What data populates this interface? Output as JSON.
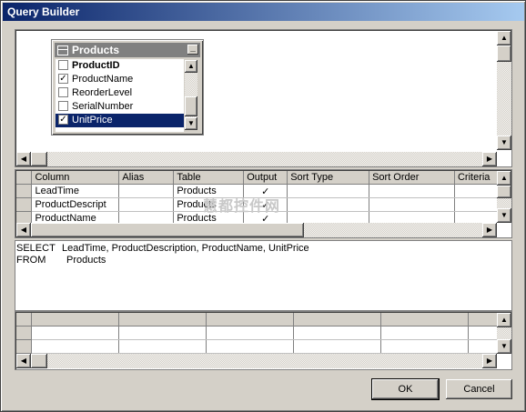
{
  "window": {
    "title": "Query Builder"
  },
  "diagram": {
    "table": {
      "name": "Products",
      "fields": [
        {
          "name": "ProductID",
          "checked": false,
          "bold": true,
          "selected": false
        },
        {
          "name": "ProductName",
          "checked": true,
          "bold": false,
          "selected": false
        },
        {
          "name": "ReorderLevel",
          "checked": false,
          "bold": false,
          "selected": false
        },
        {
          "name": "SerialNumber",
          "checked": false,
          "bold": false,
          "selected": false
        },
        {
          "name": "UnitPrice",
          "checked": true,
          "bold": false,
          "selected": true
        }
      ]
    }
  },
  "grid": {
    "columns": [
      "Column",
      "Alias",
      "Table",
      "Output",
      "Sort Type",
      "Sort Order",
      "Criteria"
    ],
    "rows": [
      {
        "column": "LeadTime",
        "alias": "",
        "table": "Products",
        "output": "✓"
      },
      {
        "column": "ProductDescript",
        "alias": "",
        "table": "Products",
        "output": "✓"
      },
      {
        "column": "ProductName",
        "alias": "",
        "table": "Products",
        "output": "✓"
      }
    ]
  },
  "sql": {
    "select_kw": "SELECT",
    "select_list": "LeadTime, ProductDescription, ProductName, UnitPrice",
    "from_kw": "FROM",
    "from_table": "Products"
  },
  "buttons": {
    "ok": "OK",
    "cancel": "Cancel"
  },
  "watermark": "慧都控件网"
}
